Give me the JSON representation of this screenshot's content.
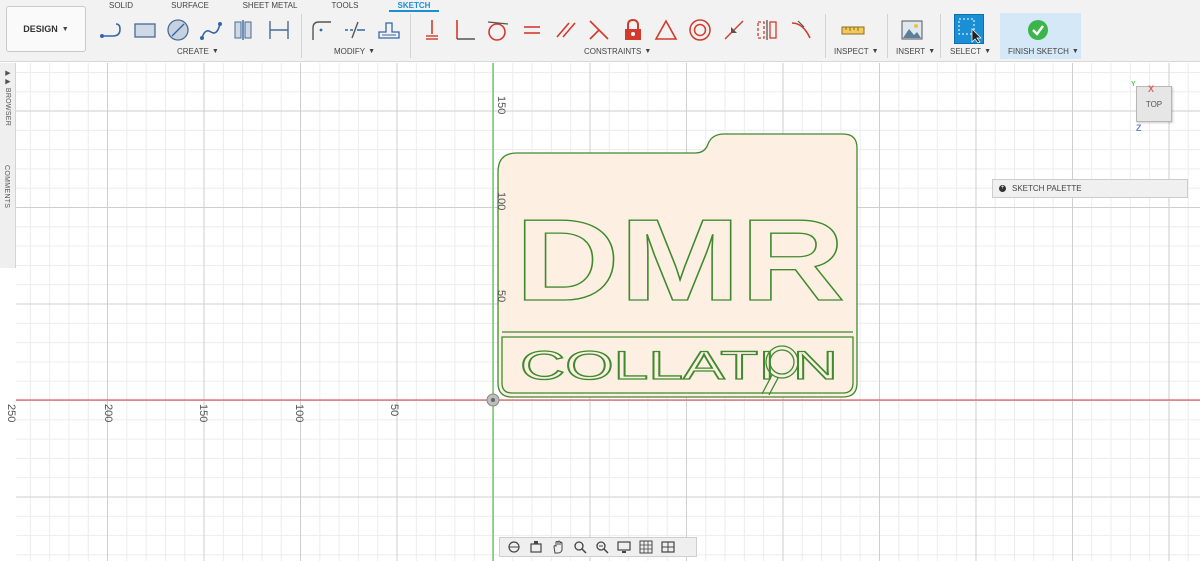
{
  "workspace": {
    "label": "DESIGN"
  },
  "tabs": [
    {
      "label": "SOLID",
      "active": false
    },
    {
      "label": "SURFACE",
      "active": false
    },
    {
      "label": "SHEET METAL",
      "active": false
    },
    {
      "label": "TOOLS",
      "active": false
    },
    {
      "label": "SKETCH",
      "active": true
    }
  ],
  "groups": {
    "create": "CREATE",
    "modify": "MODIFY",
    "constraints": "CONSTRAINTS",
    "inspect": "INSPECT",
    "insert": "INSERT",
    "select": "SELECT",
    "finish": "FINISH SKETCH"
  },
  "side_panel": {
    "browser": "BROWSER",
    "comments": "COMMENTS"
  },
  "canvas": {
    "x_axis_labels": [
      "250",
      "200",
      "150",
      "100",
      "50"
    ],
    "y_axis_labels": [
      "150",
      "100",
      "50"
    ],
    "sketch_text_top": "DMR",
    "sketch_text_bottom": "COLLATI  N"
  },
  "viewcube": {
    "face": "TOP",
    "x": "X",
    "z": "Z",
    "y": "Y"
  },
  "sketch_palette": {
    "label": "SKETCH PALETTE"
  },
  "colors": {
    "accent": "#1b8fd6",
    "sketch_line": "#3f8a2f",
    "sketch_fill": "#fdf0e2",
    "x_axis": "#e06060",
    "y_axis": "#5ac25a",
    "constraint_red": "#d33a2c"
  }
}
